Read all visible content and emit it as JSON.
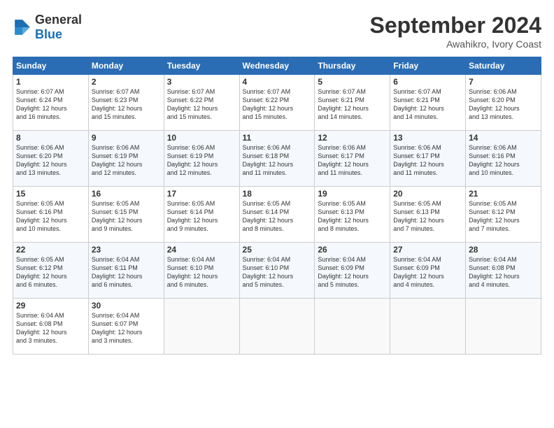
{
  "header": {
    "logo_general": "General",
    "logo_blue": "Blue",
    "month_title": "September 2024",
    "location": "Awahikro, Ivory Coast"
  },
  "calendar": {
    "days": [
      "Sunday",
      "Monday",
      "Tuesday",
      "Wednesday",
      "Thursday",
      "Friday",
      "Saturday"
    ],
    "weeks": [
      [
        {
          "day": "",
          "text": ""
        },
        {
          "day": "2",
          "text": "Sunrise: 6:07 AM\nSunset: 6:23 PM\nDaylight: 12 hours\nand 15 minutes."
        },
        {
          "day": "3",
          "text": "Sunrise: 6:07 AM\nSunset: 6:22 PM\nDaylight: 12 hours\nand 15 minutes."
        },
        {
          "day": "4",
          "text": "Sunrise: 6:07 AM\nSunset: 6:22 PM\nDaylight: 12 hours\nand 15 minutes."
        },
        {
          "day": "5",
          "text": "Sunrise: 6:07 AM\nSunset: 6:21 PM\nDaylight: 12 hours\nand 14 minutes."
        },
        {
          "day": "6",
          "text": "Sunrise: 6:07 AM\nSunset: 6:21 PM\nDaylight: 12 hours\nand 14 minutes."
        },
        {
          "day": "7",
          "text": "Sunrise: 6:06 AM\nSunset: 6:20 PM\nDaylight: 12 hours\nand 13 minutes."
        }
      ],
      [
        {
          "day": "8",
          "text": "Sunrise: 6:06 AM\nSunset: 6:20 PM\nDaylight: 12 hours\nand 13 minutes."
        },
        {
          "day": "9",
          "text": "Sunrise: 6:06 AM\nSunset: 6:19 PM\nDaylight: 12 hours\nand 12 minutes."
        },
        {
          "day": "10",
          "text": "Sunrise: 6:06 AM\nSunset: 6:19 PM\nDaylight: 12 hours\nand 12 minutes."
        },
        {
          "day": "11",
          "text": "Sunrise: 6:06 AM\nSunset: 6:18 PM\nDaylight: 12 hours\nand 11 minutes."
        },
        {
          "day": "12",
          "text": "Sunrise: 6:06 AM\nSunset: 6:17 PM\nDaylight: 12 hours\nand 11 minutes."
        },
        {
          "day": "13",
          "text": "Sunrise: 6:06 AM\nSunset: 6:17 PM\nDaylight: 12 hours\nand 11 minutes."
        },
        {
          "day": "14",
          "text": "Sunrise: 6:06 AM\nSunset: 6:16 PM\nDaylight: 12 hours\nand 10 minutes."
        }
      ],
      [
        {
          "day": "15",
          "text": "Sunrise: 6:05 AM\nSunset: 6:16 PM\nDaylight: 12 hours\nand 10 minutes."
        },
        {
          "day": "16",
          "text": "Sunrise: 6:05 AM\nSunset: 6:15 PM\nDaylight: 12 hours\nand 9 minutes."
        },
        {
          "day": "17",
          "text": "Sunrise: 6:05 AM\nSunset: 6:14 PM\nDaylight: 12 hours\nand 9 minutes."
        },
        {
          "day": "18",
          "text": "Sunrise: 6:05 AM\nSunset: 6:14 PM\nDaylight: 12 hours\nand 8 minutes."
        },
        {
          "day": "19",
          "text": "Sunrise: 6:05 AM\nSunset: 6:13 PM\nDaylight: 12 hours\nand 8 minutes."
        },
        {
          "day": "20",
          "text": "Sunrise: 6:05 AM\nSunset: 6:13 PM\nDaylight: 12 hours\nand 7 minutes."
        },
        {
          "day": "21",
          "text": "Sunrise: 6:05 AM\nSunset: 6:12 PM\nDaylight: 12 hours\nand 7 minutes."
        }
      ],
      [
        {
          "day": "22",
          "text": "Sunrise: 6:05 AM\nSunset: 6:12 PM\nDaylight: 12 hours\nand 6 minutes."
        },
        {
          "day": "23",
          "text": "Sunrise: 6:04 AM\nSunset: 6:11 PM\nDaylight: 12 hours\nand 6 minutes."
        },
        {
          "day": "24",
          "text": "Sunrise: 6:04 AM\nSunset: 6:10 PM\nDaylight: 12 hours\nand 6 minutes."
        },
        {
          "day": "25",
          "text": "Sunrise: 6:04 AM\nSunset: 6:10 PM\nDaylight: 12 hours\nand 5 minutes."
        },
        {
          "day": "26",
          "text": "Sunrise: 6:04 AM\nSunset: 6:09 PM\nDaylight: 12 hours\nand 5 minutes."
        },
        {
          "day": "27",
          "text": "Sunrise: 6:04 AM\nSunset: 6:09 PM\nDaylight: 12 hours\nand 4 minutes."
        },
        {
          "day": "28",
          "text": "Sunrise: 6:04 AM\nSunset: 6:08 PM\nDaylight: 12 hours\nand 4 minutes."
        }
      ],
      [
        {
          "day": "29",
          "text": "Sunrise: 6:04 AM\nSunset: 6:08 PM\nDaylight: 12 hours\nand 3 minutes."
        },
        {
          "day": "30",
          "text": "Sunrise: 6:04 AM\nSunset: 6:07 PM\nDaylight: 12 hours\nand 3 minutes."
        },
        {
          "day": "",
          "text": ""
        },
        {
          "day": "",
          "text": ""
        },
        {
          "day": "",
          "text": ""
        },
        {
          "day": "",
          "text": ""
        },
        {
          "day": "",
          "text": ""
        }
      ]
    ],
    "week1_day1": {
      "day": "1",
      "text": "Sunrise: 6:07 AM\nSunset: 6:24 PM\nDaylight: 12 hours\nand 16 minutes."
    }
  }
}
